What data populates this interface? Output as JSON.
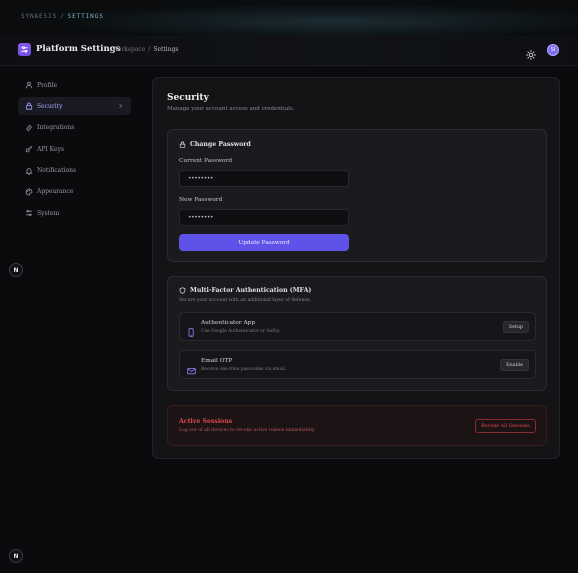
{
  "topbar": {
    "brand": "SYNAESIS",
    "separator": "/",
    "page": "SETTINGS"
  },
  "header": {
    "title": "Platform Settings",
    "breadcrumbs": [
      "Workspace",
      "Settings"
    ],
    "breadcrumb_separator": "/",
    "avatar_initials": "SI"
  },
  "sidebar": {
    "items": [
      {
        "label": "Profile",
        "icon": "user-icon"
      },
      {
        "label": "Security",
        "icon": "lock-icon",
        "active": true
      },
      {
        "label": "Integrations",
        "icon": "link-icon"
      },
      {
        "label": "API Keys",
        "icon": "key-icon"
      },
      {
        "label": "Notifications",
        "icon": "bell-icon"
      },
      {
        "label": "Appearance",
        "icon": "palette-icon"
      },
      {
        "label": "System",
        "icon": "sliders-icon"
      }
    ]
  },
  "fab": {
    "label": "N"
  },
  "security": {
    "title": "Security",
    "subtitle": "Manage your account access and credentials.",
    "change_password": {
      "title": "Change Password",
      "current_label": "Current Password",
      "current_value": "••••••••",
      "new_label": "New Password",
      "new_value": "••••••••",
      "submit": "Update Password"
    },
    "mfa": {
      "title": "Multi-Factor Authentication (MFA)",
      "subtitle": "Secure your account with an additional layer of defense.",
      "methods": [
        {
          "name": "Authenticator App",
          "desc": "Use Google Authenticator or Authy.",
          "action": "Setup",
          "icon": "smartphone-icon"
        },
        {
          "name": "Email OTP",
          "desc": "Receive one-time passcodes via email.",
          "action": "Enable",
          "icon": "mail-icon"
        }
      ]
    },
    "sessions": {
      "title": "Active Sessions",
      "desc": "Log out of all devices to revoke active tokens immediately.",
      "action": "Revoke All Sessions"
    }
  },
  "colors": {
    "accent": "#5f52e9",
    "danger": "#e0484f",
    "brand": "#8b5cf6"
  }
}
